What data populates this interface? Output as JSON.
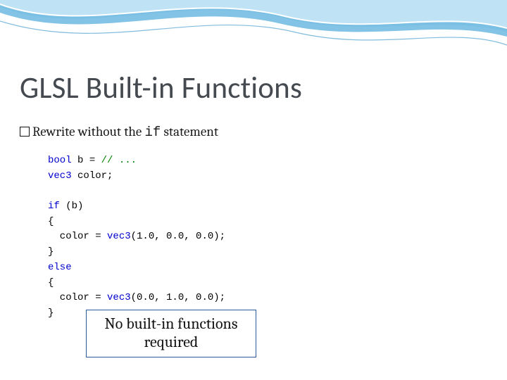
{
  "title": "GLSL Built-in Functions",
  "subtitle": {
    "prefix": "Rewrite without the ",
    "code": "if",
    "suffix": " statement"
  },
  "code": {
    "l1a": "bool",
    "l1b": " b = ",
    "l1c": "// ...",
    "l2a": "vec3",
    "l2b": " color;",
    "l3": "",
    "l4a": "if",
    "l4b": " (b)",
    "l5": "{",
    "l6a": "  color = ",
    "l6b": "vec3",
    "l6c": "(1.0, 0.0, 0.0);",
    "l7": "}",
    "l8a": "else",
    "l9": "{",
    "l10a": "  color = ",
    "l10b": "vec3",
    "l10c": "(0.0, 1.0, 0.0);",
    "l11": "}"
  },
  "callout": "No built-in functions required",
  "colors": {
    "wave1": "#bfe3f5",
    "wave2": "#6db8e0",
    "wave3": "#2f8fc6",
    "stroke": "#ffffff"
  }
}
